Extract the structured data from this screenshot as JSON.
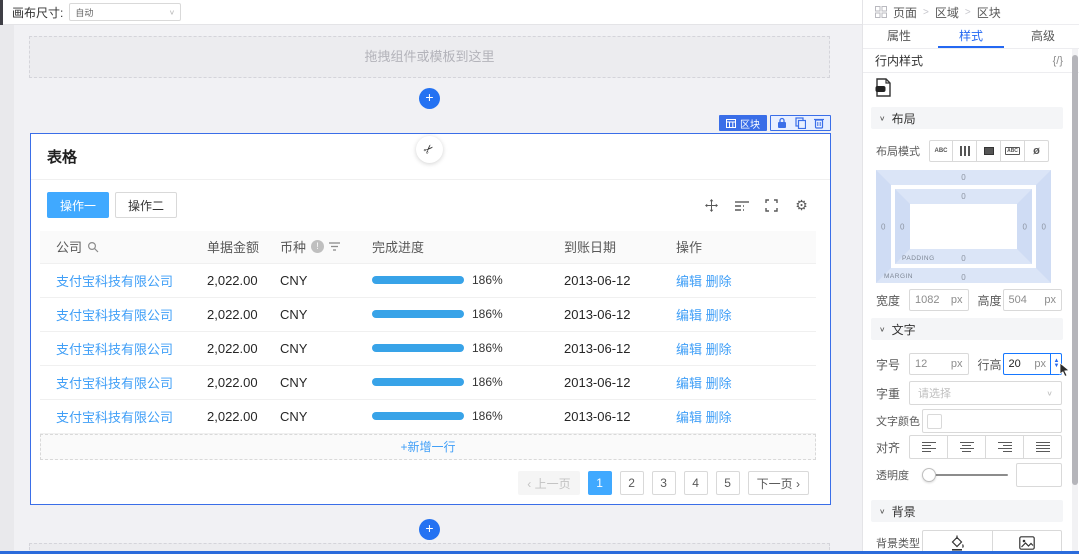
{
  "topbar": {
    "canvas_size_label": "画布尺寸:",
    "canvas_size_value": "自动"
  },
  "icons": {
    "plus": "+",
    "scissors": "✂",
    "chevron_down": "∨",
    "prev_arrow": "‹",
    "next_arrow": "›",
    "gear": "⚙",
    "eye_off": "ø"
  },
  "canvas": {
    "dropzone_text": "拖拽组件或模板到这里",
    "block": {
      "tag_label": "区块",
      "title": "表格",
      "action_buttons": [
        "操作一",
        "操作二"
      ],
      "table": {
        "columns": [
          "公司",
          "单据金额",
          "币种",
          "完成进度",
          "到账日期",
          "操作"
        ],
        "rows": [
          {
            "company": "支付宝科技有限公司",
            "amount": "2,022.00",
            "currency": "CNY",
            "progress": "186%",
            "date": "2013-06-12",
            "edit": "编辑",
            "delete": "删除"
          },
          {
            "company": "支付宝科技有限公司",
            "amount": "2,022.00",
            "currency": "CNY",
            "progress": "186%",
            "date": "2013-06-12",
            "edit": "编辑",
            "delete": "删除"
          },
          {
            "company": "支付宝科技有限公司",
            "amount": "2,022.00",
            "currency": "CNY",
            "progress": "186%",
            "date": "2013-06-12",
            "edit": "编辑",
            "delete": "删除"
          },
          {
            "company": "支付宝科技有限公司",
            "amount": "2,022.00",
            "currency": "CNY",
            "progress": "186%",
            "date": "2013-06-12",
            "edit": "编辑",
            "delete": "删除"
          },
          {
            "company": "支付宝科技有限公司",
            "amount": "2,022.00",
            "currency": "CNY",
            "progress": "186%",
            "date": "2013-06-12",
            "edit": "编辑",
            "delete": "删除"
          }
        ],
        "add_row_label": "+新增一行"
      },
      "pagination": {
        "prev_label": "上一页",
        "pages": [
          {
            "label": "1",
            "active": true
          },
          {
            "label": "2"
          },
          {
            "label": "3"
          },
          {
            "label": "4"
          },
          {
            "label": "5"
          }
        ],
        "next_label": "下一页"
      }
    }
  },
  "panel": {
    "breadcrumb": [
      "页面",
      "区域",
      "区块"
    ],
    "tabs": {
      "attrs": "属性",
      "style": "样式",
      "advanced": "高级"
    },
    "inline_style": {
      "label": "行内样式",
      "braces": "{/}"
    },
    "layout": {
      "title": "布局",
      "mode_label": "布局模式",
      "margin_label": "MARGIN",
      "padding_label": "PADDING",
      "zero": "0",
      "width_label": "宽度",
      "width_value": "1082",
      "width_unit": "px",
      "height_label": "高度",
      "height_value": "504",
      "height_unit": "px"
    },
    "text": {
      "title": "文字",
      "font_size_label": "字号",
      "font_size_value": "12",
      "font_size_unit": "px",
      "line_height_label": "行高",
      "line_height_value": "20",
      "line_height_unit": "px",
      "weight_label": "字重",
      "weight_placeholder": "请选择",
      "color_label": "文字颜色",
      "align_label": "对齐",
      "opacity_label": "透明度"
    },
    "background": {
      "title": "背景",
      "type_label": "背景类型"
    }
  },
  "colors": {
    "accent_blue": "#3a6ee8",
    "primary_button": "#40a9ff",
    "link": "#409ff7",
    "progress": "#38a3e8",
    "bottom_bar": "#2b6bdb",
    "boxmodel_fill": "#dbe5f7"
  }
}
